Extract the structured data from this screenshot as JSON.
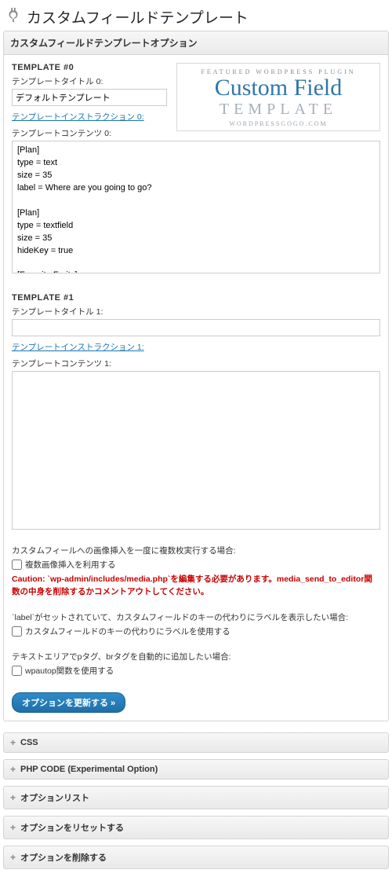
{
  "header": {
    "title": "カスタムフィールドテンプレート"
  },
  "panel": {
    "title": "カスタムフィールドテンプレートオプション"
  },
  "promo": {
    "line1": "FEATURED WORDPRESS PLUGIN",
    "line2": "Custom Field",
    "line3": "TEMPLATE",
    "line4": "WORDPRESSGOGO.COM"
  },
  "templates": [
    {
      "heading": "TEMPLATE #0",
      "title_label": "テンプレートタイトル 0:",
      "title_value": "デフォルトテンプレート",
      "instruction_label": "テンプレートインストラクション 0:",
      "content_label": "テンプレートコンテンツ 0:",
      "content_value": "[Plan]\ntype = text\nsize = 35\nlabel = Where are you going to go?\n\n[Plan]\ntype = textfield\nsize = 35\nhideKey = true\n\n[Favorite Fruits]"
    },
    {
      "heading": "TEMPLATE #1",
      "title_label": "テンプレートタイトル 1:",
      "title_value": "",
      "instruction_label": "テンプレートインストラクション 1:",
      "content_label": "テンプレートコンテンツ 1:",
      "content_value": ""
    }
  ],
  "options": {
    "multi_insert_intro": "カスタムフィールへの画像挿入を一度に複数枚実行する場合:",
    "multi_insert_check": "複数画像挿入を利用する",
    "multi_insert_caution": "Caution: `wp-admin/includes/media.php`を編集する必要があります。media_send_to_editor関数の中身を削除するかコメントアウトしてください。",
    "label_intro": "`label`がセットされていて、カスタムフィールドのキーの代わりにラベルを表示したい場合:",
    "label_check": "カスタムフィールドのキーの代わりにラベルを使用する",
    "wpautop_intro": "テキストエリアでpタグ、brタグを自動的に追加したい場合:",
    "wpautop_check": "wpautop関数を使用する"
  },
  "buttons": {
    "save": "オプションを更新する »"
  },
  "accordions": [
    "CSS",
    "PHP CODE (Experimental Option)",
    "オプションリスト",
    "オプションをリセットする",
    "オプションを削除する"
  ]
}
